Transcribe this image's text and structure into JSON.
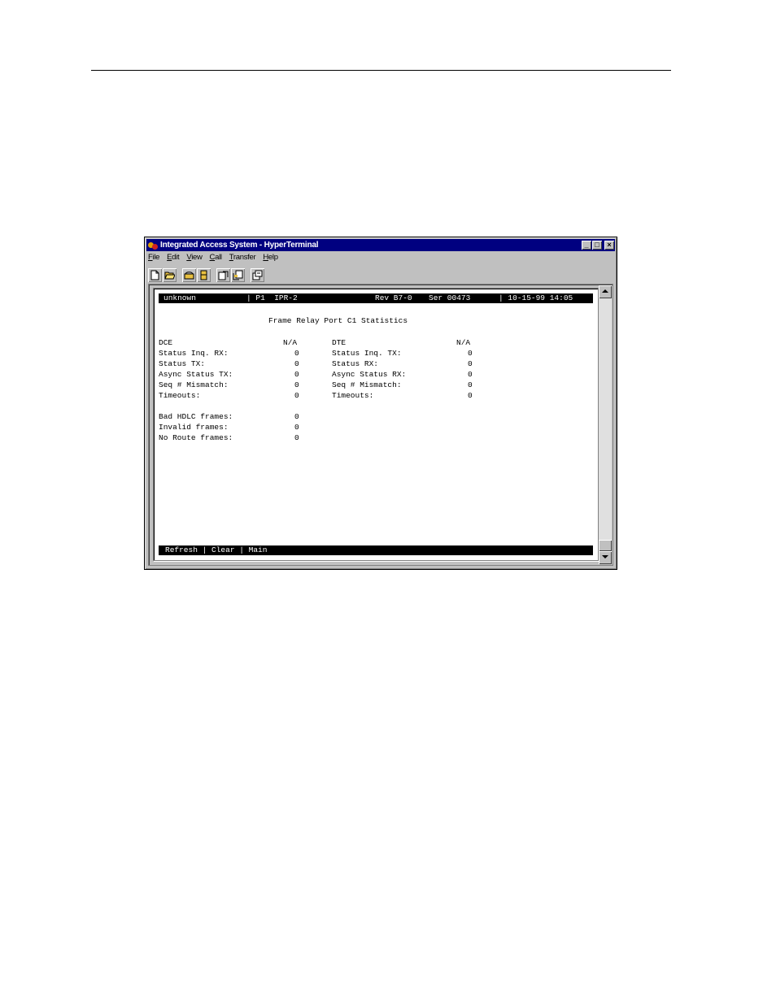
{
  "window": {
    "title": "Integrated Access System - HyperTerminal",
    "controls": {
      "minimize": "_",
      "maximize": "□",
      "close": "×"
    }
  },
  "menu": [
    {
      "first": "F",
      "rest": "ile"
    },
    {
      "first": "E",
      "rest": "dit"
    },
    {
      "first": "V",
      "rest": "iew"
    },
    {
      "first": "C",
      "rest": "all"
    },
    {
      "first": "T",
      "rest": "ransfer"
    },
    {
      "first": "H",
      "rest": "elp"
    }
  ],
  "terminal": {
    "status": {
      "user": "unknown",
      "port": "| P1  IPR-2",
      "rev": "Rev B7-0",
      "serial": "Ser 00473",
      "datetime": "| 10-15-99 14:05"
    },
    "screen_title": "Frame Relay Port C1 Statistics",
    "dce": {
      "header": "DCE",
      "header_value": "N/A",
      "rows": [
        {
          "label": "Status Inq. RX:",
          "value": "0"
        },
        {
          "label": "Status TX:",
          "value": "0"
        },
        {
          "label": "Async Status TX:",
          "value": "0"
        },
        {
          "label": "Seq # Mismatch:",
          "value": "0"
        },
        {
          "label": "Timeouts:",
          "value": "0"
        }
      ]
    },
    "dte": {
      "header": "DTE",
      "header_value": "N/A",
      "rows": [
        {
          "label": "Status Inq. TX:",
          "value": "0"
        },
        {
          "label": "Status RX:",
          "value": "0"
        },
        {
          "label": "Async Status RX:",
          "value": "0"
        },
        {
          "label": "Seq # Mismatch:",
          "value": "0"
        },
        {
          "label": "Timeouts:",
          "value": "0"
        }
      ]
    },
    "frames": [
      {
        "label": "Bad HDLC frames:",
        "value": "0"
      },
      {
        "label": "Invalid frames:",
        "value": "0"
      },
      {
        "label": "No Route frames:",
        "value": "0"
      }
    ],
    "footer": {
      "refresh": "Refresh",
      "sep1": " | ",
      "clear": "Clear",
      "sep2": " | ",
      "main": "Main"
    }
  }
}
